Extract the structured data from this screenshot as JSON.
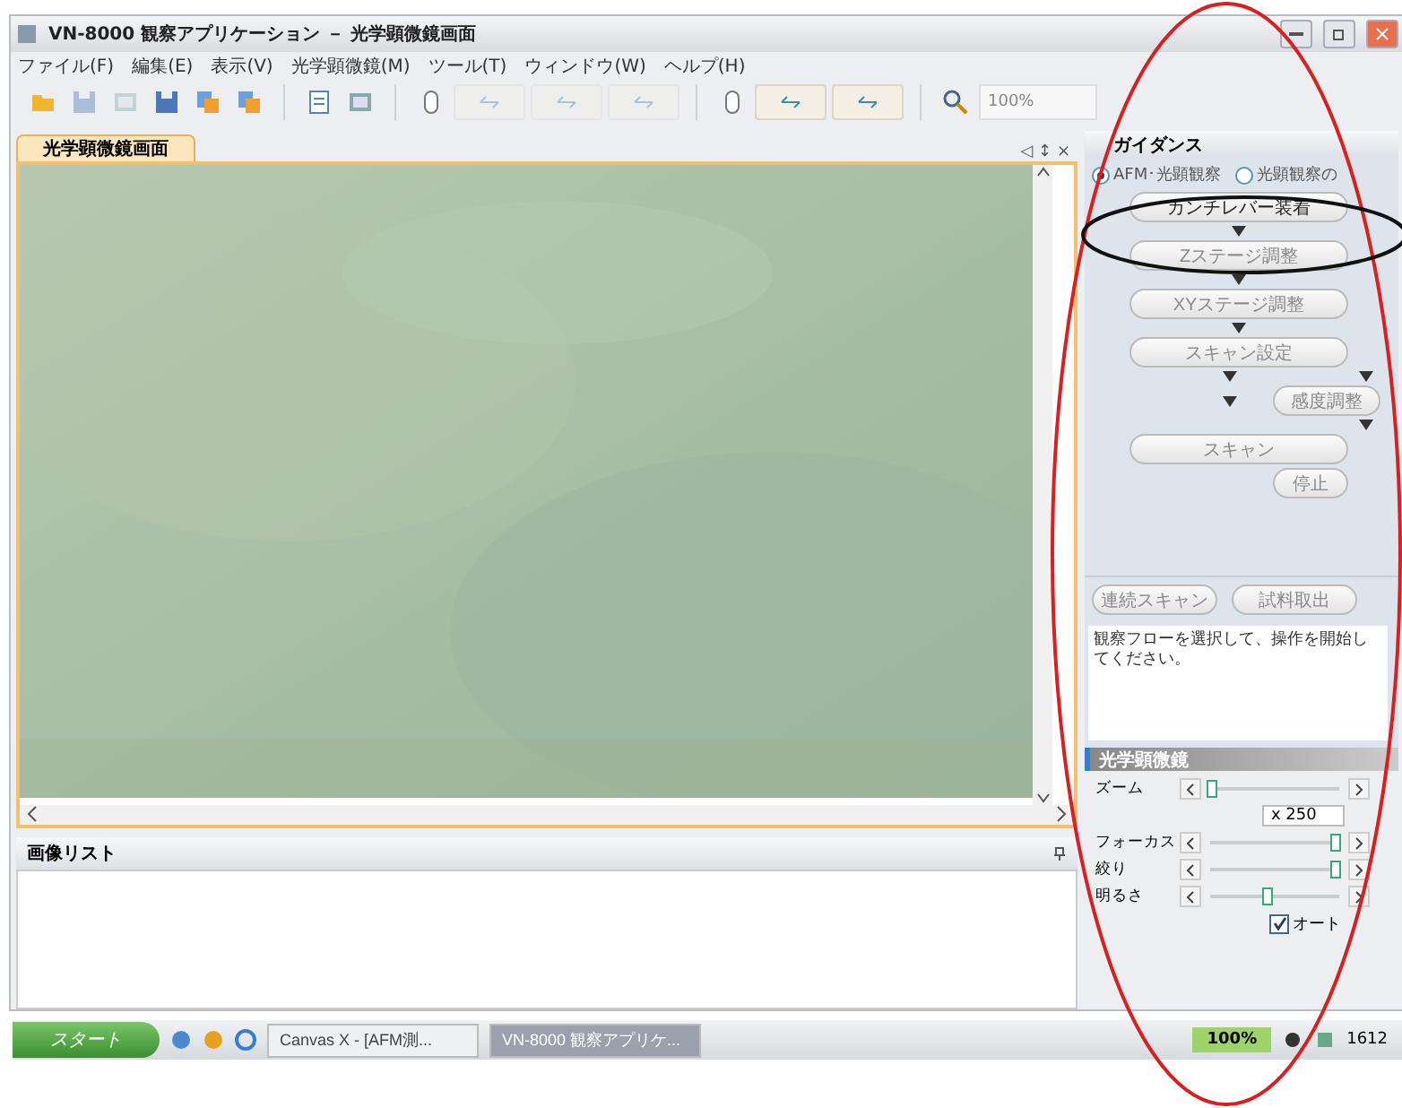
{
  "window": {
    "title": "VN-8000 観察アプリケーション － 光学顕微鏡画面"
  },
  "menu": [
    "ファイル(F)",
    "編集(E)",
    "表示(V)",
    "光学顕微鏡(M)",
    "ツール(T)",
    "ウィンドウ(W)",
    "ヘルプ(H)"
  ],
  "toolbar": [
    {
      "kind": "folder",
      "disabled": false
    },
    {
      "kind": "disk",
      "disabled": true
    },
    {
      "kind": "frame",
      "disabled": true
    },
    {
      "kind": "disk",
      "disabled": false
    },
    {
      "kind": "copy",
      "disabled": false
    },
    {
      "kind": "copy",
      "disabled": false
    },
    {
      "kind": "sep"
    },
    {
      "kind": "page",
      "disabled": false
    },
    {
      "kind": "frame",
      "disabled": false
    },
    {
      "kind": "sep"
    },
    {
      "kind": "mouse",
      "disabled": false
    },
    {
      "kind": "wide",
      "disabled": true
    },
    {
      "kind": "wide",
      "disabled": true
    },
    {
      "kind": "wide",
      "disabled": true
    },
    {
      "kind": "sep"
    },
    {
      "kind": "mouse",
      "disabled": false
    },
    {
      "kind": "wide",
      "disabled": false
    },
    {
      "kind": "wide",
      "disabled": false
    },
    {
      "kind": "sep"
    },
    {
      "kind": "search",
      "disabled": false
    }
  ],
  "zoom_combo": {
    "value": "100%",
    "disabled": true
  },
  "document": {
    "tab": "光学顕微鏡画面",
    "pane_controls": "◁ ↕ ×"
  },
  "image_list": {
    "title": "画像リスト"
  },
  "guidance": {
    "title": "ガイダンス",
    "modes": [
      {
        "label": "AFM･光顕観察",
        "selected": true
      },
      {
        "label": "光顕観察の",
        "selected": false
      }
    ],
    "steps": [
      {
        "label": "カンチレバー装着",
        "disabled": false
      },
      {
        "label": "Zステージ調整",
        "disabled": true
      },
      {
        "label": "XYステージ調整",
        "disabled": true
      },
      {
        "label": "スキャン設定",
        "disabled": true
      }
    ],
    "side_step": {
      "label": "感度調整",
      "disabled": true
    },
    "scan": {
      "label": "スキャン",
      "disabled": true
    },
    "stop": {
      "label": "停止",
      "disabled": true
    },
    "actions": [
      {
        "label": "連続スキャン",
        "disabled": true
      },
      {
        "label": "試料取出",
        "disabled": true
      }
    ],
    "message": "観察フローを選択して、操作を開始してください。"
  },
  "optical": {
    "title": "光学顕微鏡",
    "controls": [
      {
        "label": "ズーム",
        "level": 0.02,
        "reading": "x 250"
      },
      {
        "label": "フォーカス",
        "level": 0.97
      },
      {
        "label": "絞り",
        "level": 0.97
      },
      {
        "label": "明るさ",
        "level": 0.45
      }
    ],
    "auto": {
      "label": "オート",
      "checked": true
    }
  },
  "taskbar": {
    "start": "スタート",
    "tasks": [
      {
        "label": "Canvas X - [AFM測...",
        "selected": false
      },
      {
        "label": "VN-8000 観察アプリケ...",
        "selected": true
      }
    ],
    "meter": "100%",
    "clock": "1612"
  }
}
